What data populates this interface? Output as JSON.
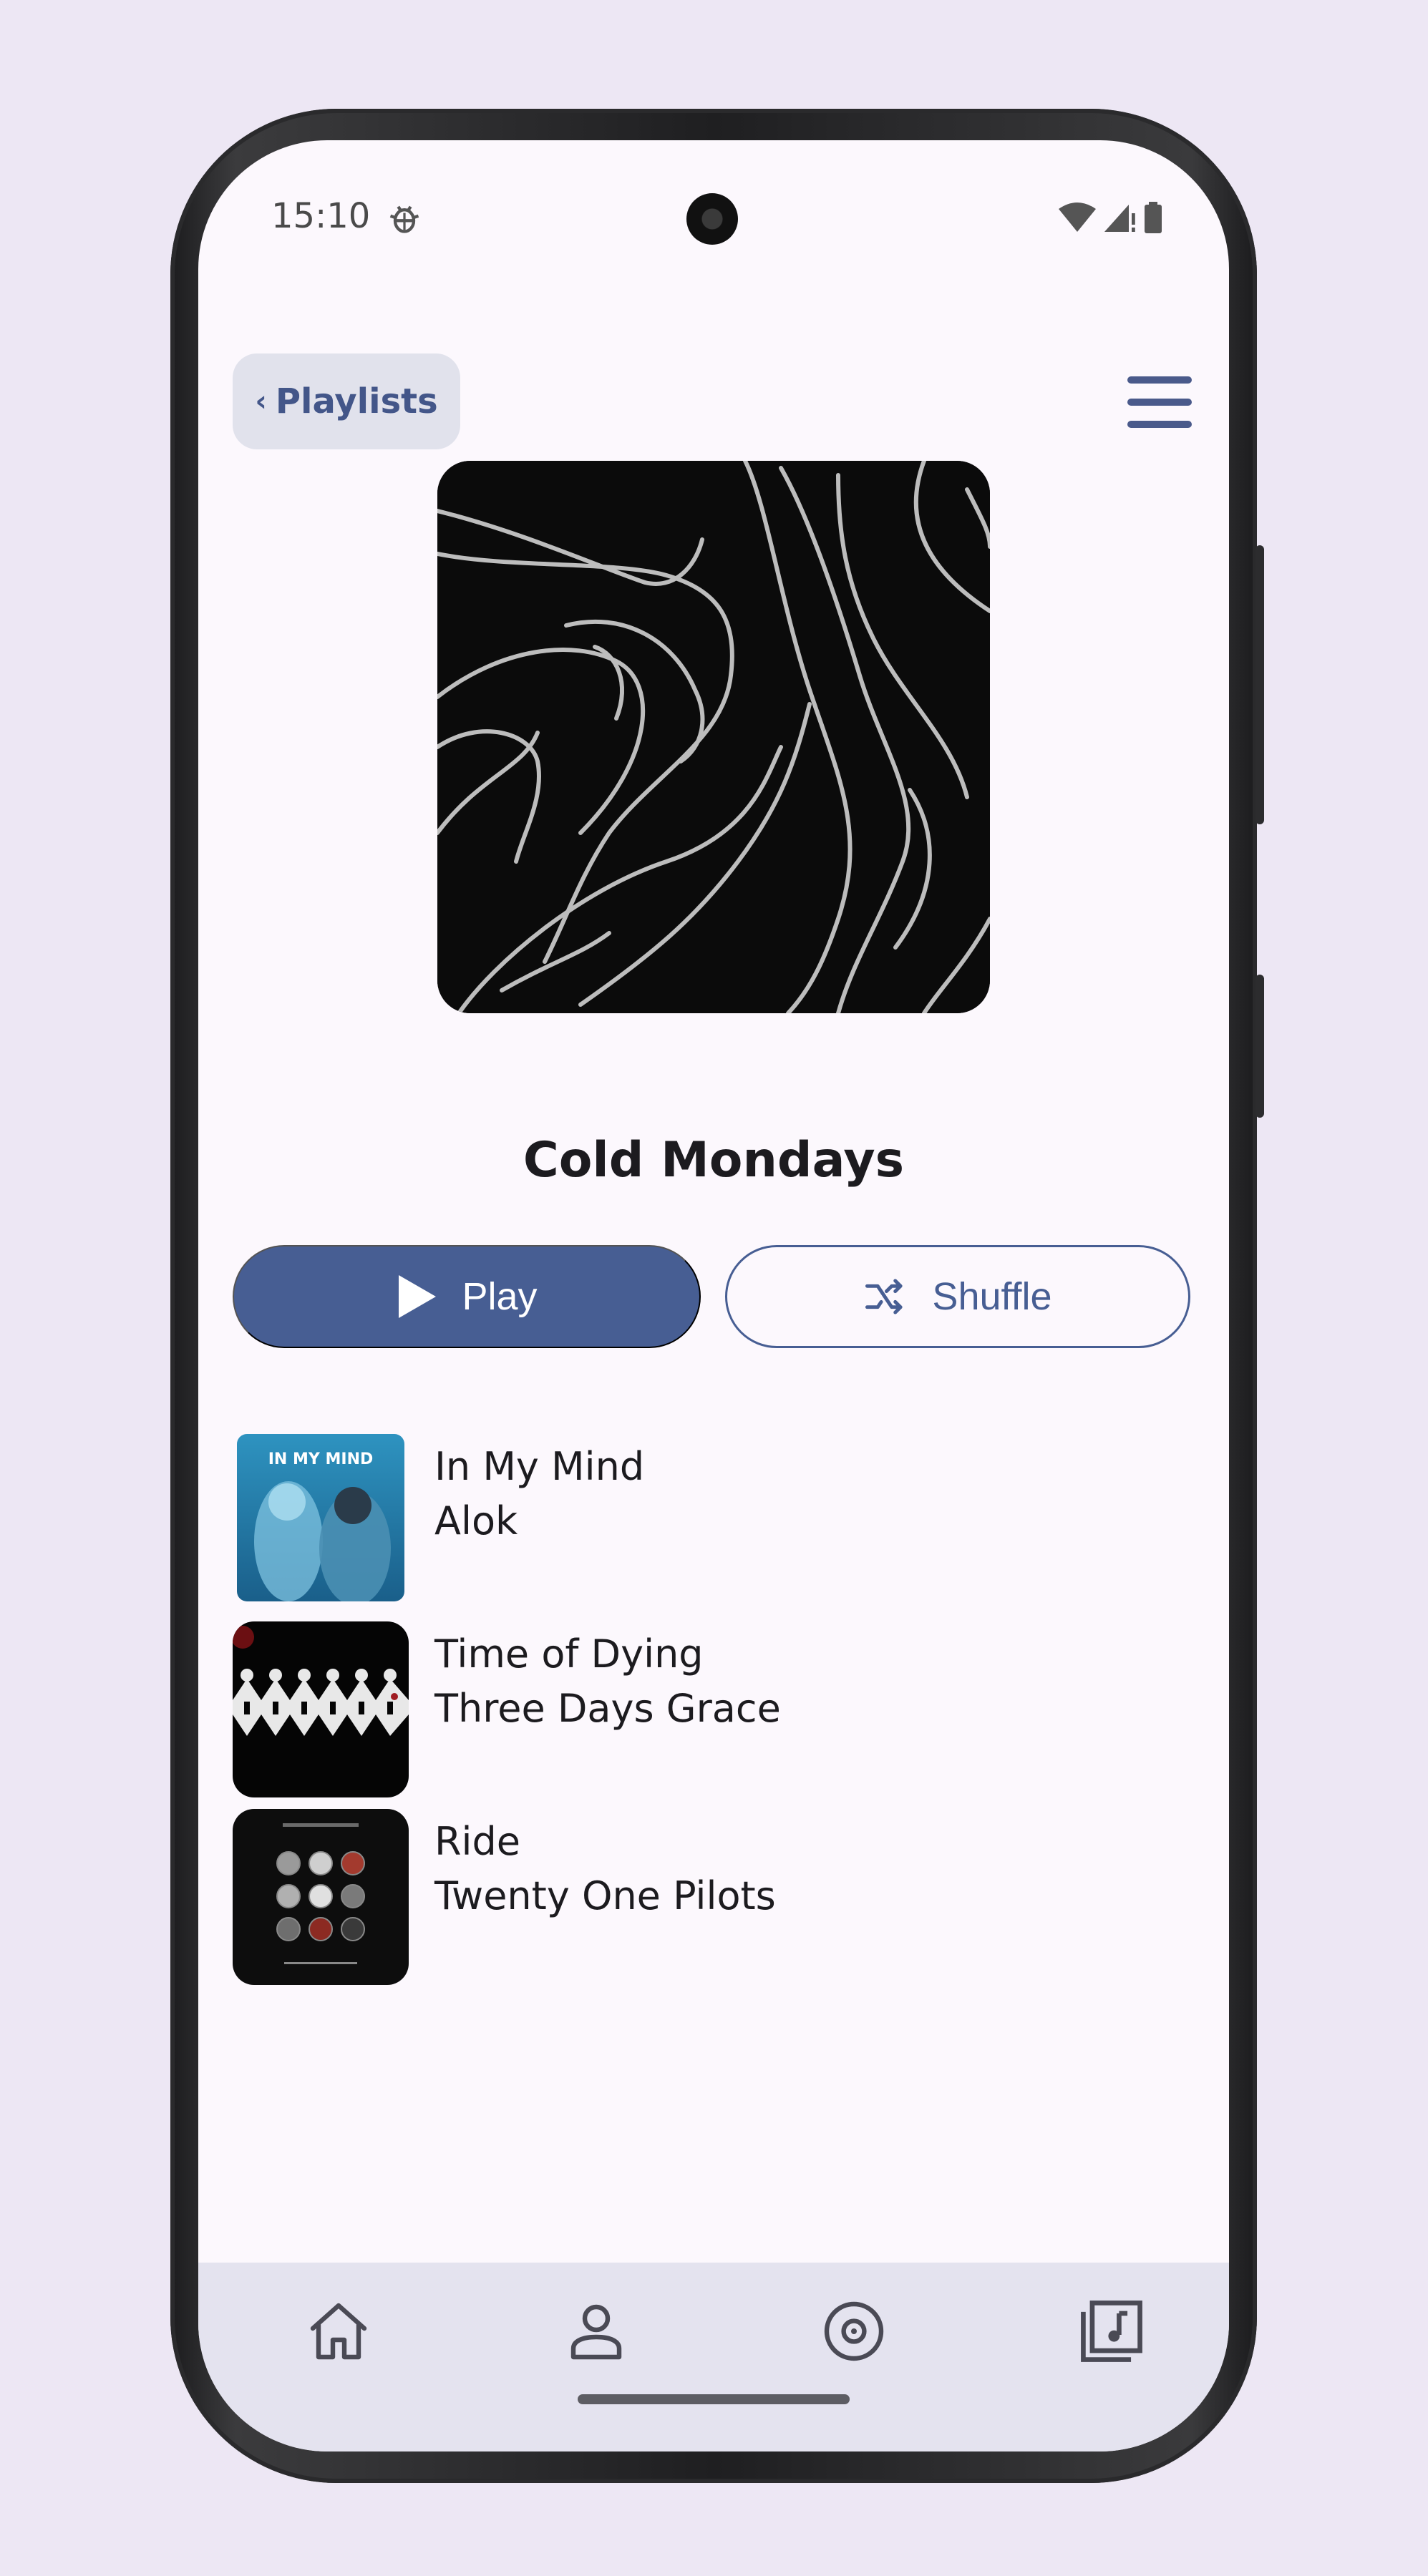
{
  "status_bar": {
    "time": "15:10"
  },
  "header": {
    "back_label": "Playlists"
  },
  "playlist": {
    "title": "Cold Mondays"
  },
  "actions": {
    "play_label": "Play",
    "shuffle_label": "Shuffle"
  },
  "songs": [
    {
      "title": "In My Mind",
      "artist": "Alok",
      "art_text": "IN MY MIND"
    },
    {
      "title": "Time of Dying",
      "artist": "Three Days Grace"
    },
    {
      "title": "Ride",
      "artist": "Twenty One Pilots"
    }
  ],
  "nav": {
    "items": [
      {
        "icon": "home-icon"
      },
      {
        "icon": "profile-icon"
      },
      {
        "icon": "disc-icon"
      },
      {
        "icon": "library-music-icon"
      }
    ]
  },
  "colors": {
    "accent": "#475e93",
    "background": "#fcf8fd",
    "nav_background": "#e4e3ef",
    "back_button_bg": "#e1e2ec"
  }
}
